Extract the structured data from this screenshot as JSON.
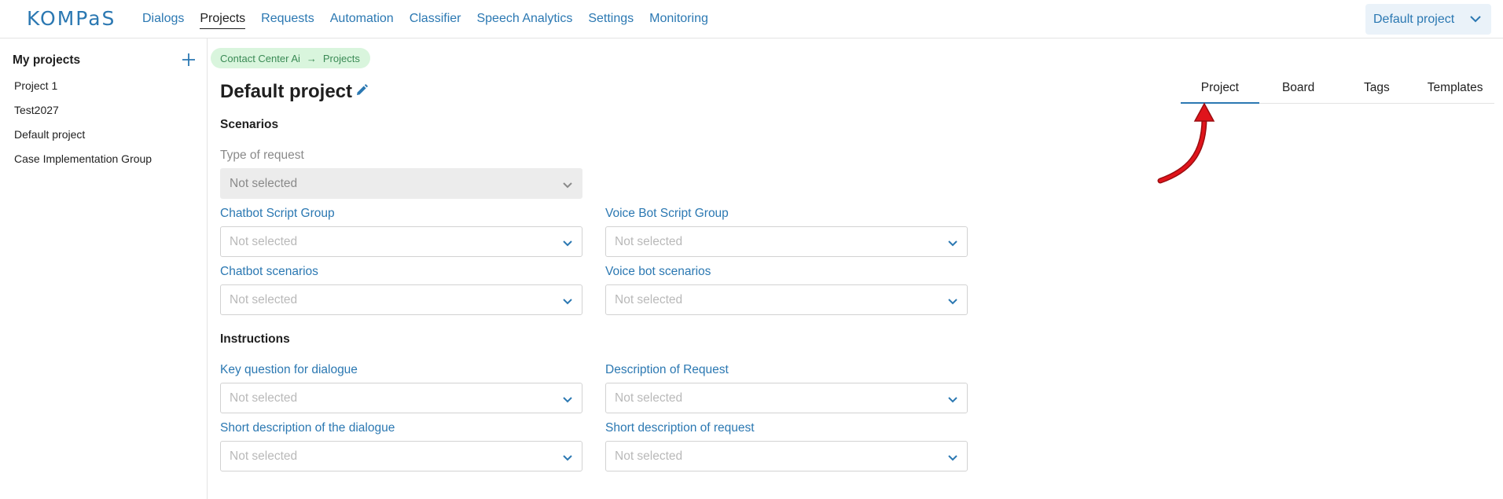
{
  "header": {
    "logo": "KOMPaS",
    "nav": [
      "Dialogs",
      "Projects",
      "Requests",
      "Automation",
      "Classifier",
      "Speech Analytics",
      "Settings",
      "Monitoring"
    ],
    "active_nav": "Projects",
    "project_selector": "Default project"
  },
  "sidebar": {
    "title": "My projects",
    "items": [
      "Project 1",
      "Test2027",
      "Default project",
      "Case Implementation Group"
    ]
  },
  "breadcrumb": {
    "root": "Contact Center Ai",
    "arrow": "→",
    "current": "Projects"
  },
  "page": {
    "title": "Default project"
  },
  "tabs": [
    "Project",
    "Board",
    "Tags",
    "Templates"
  ],
  "active_tab": "Project",
  "sections": {
    "scenarios": "Scenarios",
    "instructions": "Instructions"
  },
  "fields": {
    "type_of_request": {
      "label": "Type of request",
      "value": "Not selected"
    },
    "chatbot_script_group": {
      "label": "Chatbot Script Group",
      "value": "Not selected"
    },
    "voice_bot_script_group": {
      "label": "Voice Bot Script Group",
      "value": "Not selected"
    },
    "chatbot_scenarios": {
      "label": "Chatbot scenarios",
      "value": "Not selected"
    },
    "voice_bot_scenarios": {
      "label": "Voice bot scenarios",
      "value": "Not selected"
    },
    "key_question": {
      "label": "Key question for dialogue",
      "value": "Not selected"
    },
    "description_of_request": {
      "label": "Description of Request",
      "value": "Not selected"
    },
    "short_description_dialogue": {
      "label": "Short description of the dialogue",
      "value": "Not selected"
    },
    "short_description_request": {
      "label": "Short description of request",
      "value": "Not selected"
    }
  },
  "colors": {
    "accent": "#2b78b2",
    "breadcrumb_bg": "#d9f5dd",
    "annotation_arrow": "#e0141b"
  }
}
